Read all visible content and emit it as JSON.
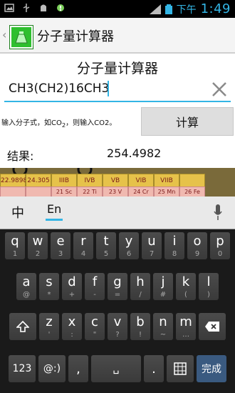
{
  "status_bar": {
    "time": "1:49",
    "am_pm": "下午"
  },
  "action_bar": {
    "title": "分子量计算器"
  },
  "main": {
    "title": "分子量计算器",
    "formula_value": "CH3(CH2)16CH3",
    "hint_prefix": "输入分子式，如CO",
    "hint_sub1": "2",
    "hint_mid": "，则输入CO2。",
    "calculate_label": "计算",
    "result_label": "结果:",
    "result_value": "254.4982"
  },
  "background_fragment": {
    "cells_top": [
      "22.9898",
      "24.305",
      "IIIB",
      "IVB",
      "VB",
      "VIB",
      "VIIB",
      ""
    ],
    "cells_bottom": [
      "",
      "",
      "21 Sc",
      "22 Ti",
      "23 V",
      "24 Cr",
      "25 Mn",
      "26 Fe"
    ]
  },
  "keyboard": {
    "lang_zh": "中",
    "lang_en": "En",
    "row1": [
      {
        "k": "q",
        "s": "1"
      },
      {
        "k": "w",
        "s": "2"
      },
      {
        "k": "e",
        "s": "3"
      },
      {
        "k": "r",
        "s": "4"
      },
      {
        "k": "t",
        "s": "5"
      },
      {
        "k": "y",
        "s": "6"
      },
      {
        "k": "u",
        "s": "7"
      },
      {
        "k": "i",
        "s": "8"
      },
      {
        "k": "o",
        "s": "9"
      },
      {
        "k": "p",
        "s": "0"
      }
    ],
    "row2": [
      {
        "k": "a",
        "s": "@"
      },
      {
        "k": "s",
        "s": "*"
      },
      {
        "k": "d",
        "s": "+"
      },
      {
        "k": "f",
        "s": "-"
      },
      {
        "k": "g",
        "s": "="
      },
      {
        "k": "h",
        "s": "/"
      },
      {
        "k": "j",
        "s": "#"
      },
      {
        "k": "k",
        "s": "("
      },
      {
        "k": "l",
        "s": ")"
      }
    ],
    "row3": [
      {
        "k": "z",
        "s": "'"
      },
      {
        "k": "x",
        "s": ":"
      },
      {
        "k": "c",
        "s": "\""
      },
      {
        "k": "v",
        "s": "?"
      },
      {
        "k": "b",
        "s": "!"
      },
      {
        "k": "n",
        "s": "~"
      },
      {
        "k": "m",
        "s": "…"
      }
    ],
    "bottom": {
      "numbers": "123",
      "symbols": "@:)",
      "comma": ",",
      "space": "␣",
      "period": ".",
      "done": "完成"
    }
  }
}
